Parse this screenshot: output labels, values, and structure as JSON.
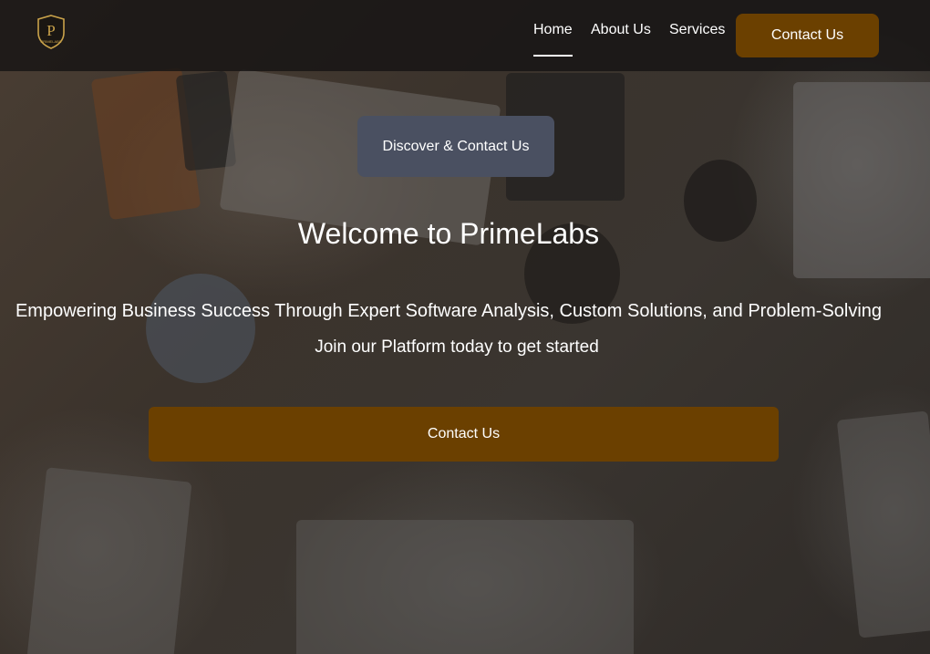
{
  "header": {
    "logo_icon": "primelabs-shield-logo-icon",
    "logo_text": "PRIMELABS",
    "nav": [
      {
        "label": "Home",
        "active": true
      },
      {
        "label": "About Us",
        "active": false
      },
      {
        "label": "Services",
        "active": false
      }
    ],
    "cta_label": "Contact Us"
  },
  "hero": {
    "badge_label": "Discover & Contact Us",
    "title": "Welcome to PrimeLabs",
    "subtitle": "Empowering Business Success Through Expert Software Analysis, Custom Solutions, and Problem-Solving",
    "tagline": "Join our Platform today to get started",
    "cta_label": "Contact Us"
  },
  "colors": {
    "accent": "#6b4000",
    "badge": "#4a5061",
    "header_bg": "#161413",
    "text": "#ffffff"
  }
}
